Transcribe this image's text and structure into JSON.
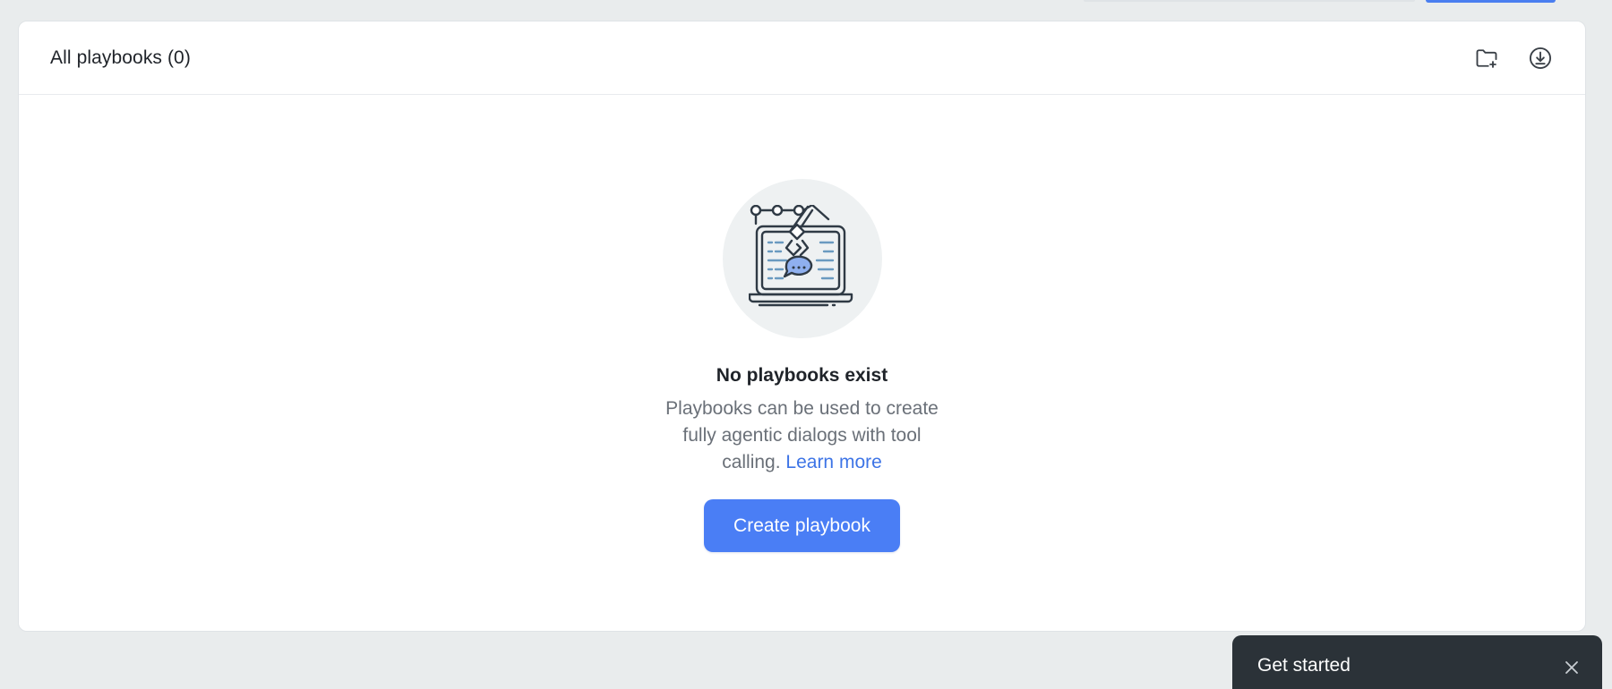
{
  "header": {
    "title": "All playbooks (0)",
    "actions": [
      {
        "icon": "folder-plus-icon",
        "label": ""
      },
      {
        "icon": "download-icon",
        "label": ""
      }
    ]
  },
  "empty_state": {
    "illustration": "laptop-robot-arm-illustration",
    "title": "No playbooks exist",
    "description": "Playbooks can be used to create fully agentic dialogs with tool calling.",
    "link_label": "Learn more",
    "button_label": "Create playbook"
  },
  "toast": {
    "title": "Get started"
  },
  "colors": {
    "accent": "#4a7ef5",
    "link": "#3d74e6",
    "background": "#e9eced",
    "toast_bg": "#2b3238"
  }
}
